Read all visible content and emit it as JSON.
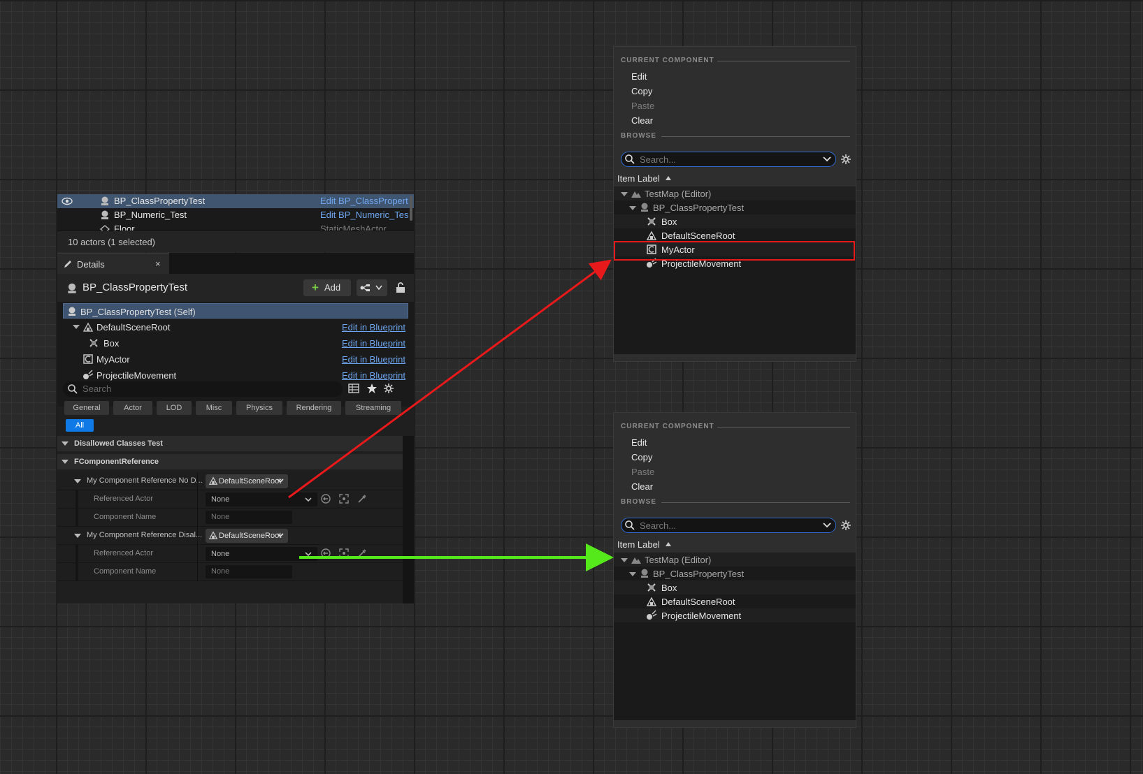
{
  "outliner": {
    "rows": [
      {
        "name": "BP_ClassPropertyTest",
        "link": "Edit BP_ClassPropert",
        "selected": true
      },
      {
        "name": "BP_Numeric_Test",
        "link": "Edit BP_Numeric_Tes",
        "selected": false
      },
      {
        "name": "Floor",
        "link": "StaticMeshActor",
        "selected": false
      }
    ],
    "footer": "10 actors (1 selected)"
  },
  "details": {
    "tab_label": "Details",
    "tab_close": "×",
    "actor_name": "BP_ClassPropertyTest",
    "add_label": "Add",
    "components": [
      {
        "name": "BP_ClassPropertyTest (Self)",
        "link": ""
      },
      {
        "name": "DefaultSceneRoot",
        "link": "Edit in Blueprint"
      },
      {
        "name": "Box",
        "link": "Edit in Blueprint"
      },
      {
        "name": "MyActor",
        "link": "Edit in Blueprint"
      },
      {
        "name": "ProjectileMovement",
        "link": "Edit in Blueprint"
      }
    ],
    "search_placeholder": "Search",
    "filters": [
      "General",
      "Actor",
      "LOD",
      "Misc",
      "Physics",
      "Rendering",
      "Streaming"
    ],
    "filter_all": "All",
    "categories": [
      "Disallowed Classes Test",
      "FComponentReference"
    ],
    "properties": {
      "ref1_label": "My Component Reference No D...",
      "ref1_value": "DefaultSceneRoot",
      "ref2_label": "My Component Reference Disal...",
      "ref2_value": "DefaultSceneRoot",
      "referenced_actor_label": "Referenced Actor",
      "referenced_actor_value": "None",
      "component_name_label": "Component Name",
      "component_name_value": "None"
    }
  },
  "picker_top": {
    "section_current": "CURRENT COMPONENT",
    "menu": [
      {
        "label": "Edit",
        "enabled": true
      },
      {
        "label": "Copy",
        "enabled": true
      },
      {
        "label": "Paste",
        "enabled": false
      },
      {
        "label": "Clear",
        "enabled": true
      }
    ],
    "section_browse": "BROWSE",
    "search_placeholder": "Search...",
    "column_header": "Item Label",
    "tree": [
      {
        "name": "TestMap (Editor)"
      },
      {
        "name": "BP_ClassPropertyTest"
      },
      {
        "name": "Box"
      },
      {
        "name": "DefaultSceneRoot"
      },
      {
        "name": "MyActor",
        "highlighted": true
      },
      {
        "name": "ProjectileMovement"
      }
    ]
  },
  "picker_bottom": {
    "section_current": "CURRENT COMPONENT",
    "menu": [
      {
        "label": "Edit",
        "enabled": true
      },
      {
        "label": "Copy",
        "enabled": true
      },
      {
        "label": "Paste",
        "enabled": false
      },
      {
        "label": "Clear",
        "enabled": true
      }
    ],
    "section_browse": "BROWSE",
    "search_placeholder": "Search...",
    "column_header": "Item Label",
    "tree": [
      {
        "name": "TestMap (Editor)"
      },
      {
        "name": "BP_ClassPropertyTest"
      },
      {
        "name": "Box"
      },
      {
        "name": "DefaultSceneRoot"
      },
      {
        "name": "ProjectileMovement"
      }
    ]
  },
  "colors": {
    "arrow_red": "#e8191a",
    "arrow_green": "#55e81a",
    "link_blue": "#6fa7f0",
    "selection": "#40556f",
    "accent": "#0f7ae5"
  }
}
